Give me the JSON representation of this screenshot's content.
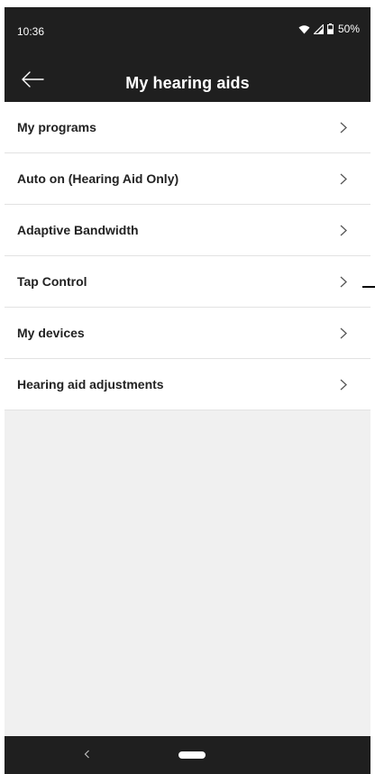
{
  "status_bar": {
    "time": "10:36",
    "battery": "50%",
    "icons": [
      "wifi-icon",
      "signal-icon",
      "battery-icon"
    ]
  },
  "app_bar": {
    "title": "My hearing aids",
    "back_icon": "arrow-left-icon"
  },
  "menu": {
    "items": [
      {
        "label": "My programs"
      },
      {
        "label": "Auto on (Hearing Aid Only)"
      },
      {
        "label": "Adaptive Bandwidth"
      },
      {
        "label": "Tap Control"
      },
      {
        "label": "My devices"
      },
      {
        "label": "Hearing aid adjustments"
      }
    ],
    "chevron_icon": "chevron-right-icon"
  },
  "nav_bar": {
    "back_icon": "chevron-left-icon",
    "home_icon": "home-pill-icon"
  },
  "colors": {
    "bars": "#1f1f1f",
    "content_bg": "#f0f0f0",
    "row_bg": "#ffffff",
    "text": "#222222"
  }
}
